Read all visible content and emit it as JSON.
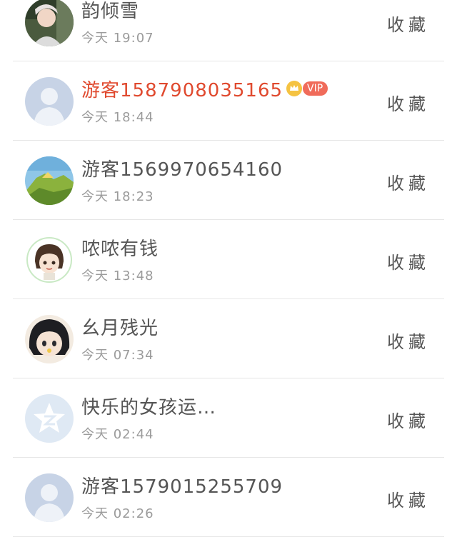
{
  "list": {
    "items": [
      {
        "name": "韵倾雪",
        "time": "今天 19:07",
        "action": "收藏",
        "avatar": "photo-avatar",
        "vip": false
      },
      {
        "name": "游客1587908035165",
        "time": "今天 18:44",
        "action": "收藏",
        "avatar": "default-avatar",
        "vip": true,
        "vip_label": "VIP"
      },
      {
        "name": "游客1569970654160",
        "time": "今天 18:23",
        "action": "收藏",
        "avatar": "landscape-avatar",
        "vip": false
      },
      {
        "name": "哝哝有钱",
        "time": "今天 13:48",
        "action": "收藏",
        "avatar": "cartoon-avatar",
        "vip": false
      },
      {
        "name": "幺月残光",
        "time": "今天 07:34",
        "action": "收藏",
        "avatar": "anime-avatar",
        "vip": false
      },
      {
        "name": "快乐的女孩运…",
        "time": "今天 02:44",
        "action": "收藏",
        "avatar": "qzone-avatar",
        "vip": false
      },
      {
        "name": "游客1579015255709",
        "time": "今天 02:26",
        "action": "收藏",
        "avatar": "default-avatar",
        "vip": false
      }
    ]
  },
  "colors": {
    "vip_name": "#e04a2f",
    "vip_badge": "#f06b5a",
    "text": "#555555",
    "muted": "#9b9b9b"
  }
}
